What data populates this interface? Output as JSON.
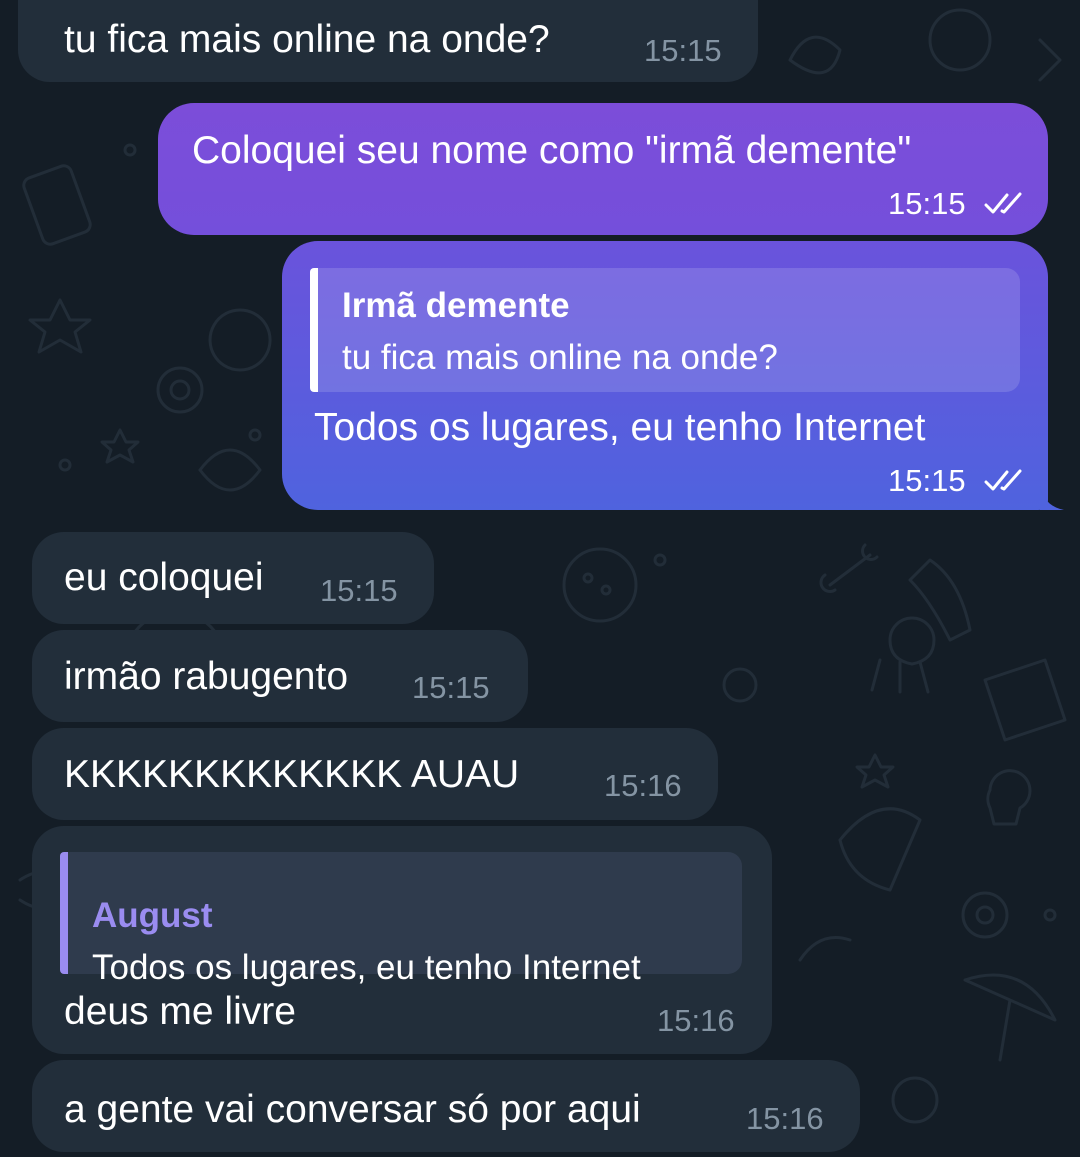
{
  "messages": [
    {
      "text": "tu fica mais online na onde?",
      "time": "15:15"
    },
    {
      "text": "Coloquei seu nome como \"irmã demente\"",
      "time": "15:15"
    },
    {
      "reply_name": "Irmã demente",
      "reply_text": "tu fica mais online na onde?",
      "text": "Todos os lugares, eu tenho Internet",
      "time": "15:15"
    },
    {
      "text": "eu coloquei",
      "time": "15:15"
    },
    {
      "text": "irmão rabugento",
      "time": "15:15"
    },
    {
      "text": "KKKKKKKKKKKKK AUAU",
      "time": "15:16"
    },
    {
      "reply_name": "August",
      "reply_text": "Todos os lugares, eu tenho Internet",
      "text": "deus me livre",
      "time": "15:16"
    },
    {
      "text": "a gente vai conversar só por aqui",
      "time": "15:16"
    }
  ],
  "colors": {
    "background": "#141d26",
    "incoming_bubble": "#222e3a",
    "outgoing_gradient_top": "#7b4fd9",
    "outgoing_gradient_bottom": "#4e63de",
    "incoming_time": "#8494a3",
    "reply_accent_incoming": "#9a8cf0",
    "read_ticks": "#ffffff"
  },
  "icons": {
    "read_status": "double-check-icon"
  }
}
